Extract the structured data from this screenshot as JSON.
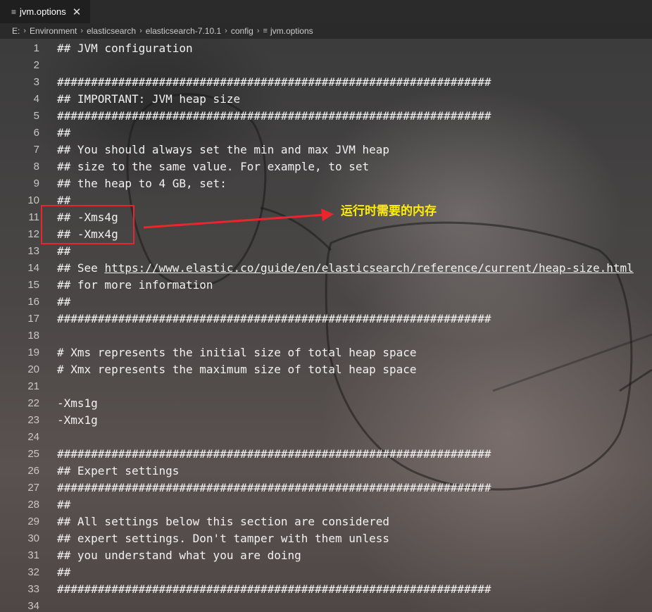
{
  "tab": {
    "icon": "lines-file-icon",
    "title": "jvm.options",
    "close": "✕"
  },
  "breadcrumb": [
    "E:",
    "Environment",
    "elasticsearch",
    "elasticsearch-7.10.1",
    "config",
    "jvm.options"
  ],
  "annotation": {
    "text": "运行时需要的内存"
  },
  "lines": [
    {
      "n": "1",
      "text": "## JVM configuration"
    },
    {
      "n": "2",
      "text": ""
    },
    {
      "n": "3",
      "text": "################################################################"
    },
    {
      "n": "4",
      "text": "## IMPORTANT: JVM heap size"
    },
    {
      "n": "5",
      "text": "################################################################"
    },
    {
      "n": "6",
      "text": "##"
    },
    {
      "n": "7",
      "text": "## You should always set the min and max JVM heap"
    },
    {
      "n": "8",
      "text": "## size to the same value. For example, to set"
    },
    {
      "n": "9",
      "text": "## the heap to 4 GB, set:"
    },
    {
      "n": "10",
      "text": "##"
    },
    {
      "n": "11",
      "text": "## -Xms4g"
    },
    {
      "n": "12",
      "text": "## -Xmx4g"
    },
    {
      "n": "13",
      "text": "##"
    },
    {
      "n": "14",
      "prefix": "## See ",
      "link": "https://www.elastic.co/guide/en/elasticsearch/reference/current/heap-size.html"
    },
    {
      "n": "15",
      "text": "## for more information"
    },
    {
      "n": "16",
      "text": "##"
    },
    {
      "n": "17",
      "text": "################################################################"
    },
    {
      "n": "18",
      "text": ""
    },
    {
      "n": "19",
      "text": "# Xms represents the initial size of total heap space"
    },
    {
      "n": "20",
      "text": "# Xmx represents the maximum size of total heap space"
    },
    {
      "n": "21",
      "text": ""
    },
    {
      "n": "22",
      "text": "-Xms1g"
    },
    {
      "n": "23",
      "text": "-Xmx1g"
    },
    {
      "n": "24",
      "text": ""
    },
    {
      "n": "25",
      "text": "################################################################"
    },
    {
      "n": "26",
      "text": "## Expert settings"
    },
    {
      "n": "27",
      "text": "################################################################"
    },
    {
      "n": "28",
      "text": "##"
    },
    {
      "n": "29",
      "text": "## All settings below this section are considered"
    },
    {
      "n": "30",
      "text": "## expert settings. Don't tamper with them unless"
    },
    {
      "n": "31",
      "text": "## you understand what you are doing"
    },
    {
      "n": "32",
      "text": "##"
    },
    {
      "n": "33",
      "text": "################################################################"
    },
    {
      "n": "34",
      "text": ""
    }
  ]
}
